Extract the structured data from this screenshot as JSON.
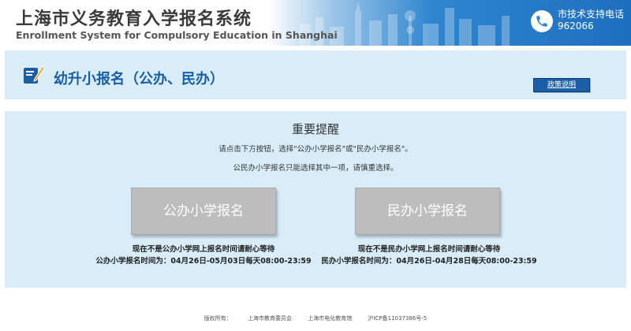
{
  "header": {
    "title_cn": "上海市义务教育入学报名系统",
    "title_en": "Enrollment System for Compulsory Education in Shanghai",
    "hotline_label": "市技术支持电话",
    "hotline_number": "962066",
    "phone_icon": "phone-icon"
  },
  "section": {
    "icon": "edit-icon",
    "title": "幼升小报名（公办、民办）",
    "policy_button": "政策说明"
  },
  "notice": {
    "title": "重要提醒",
    "line1": "请点击下方按钮，选择\"公办小学报名\"或\"民办小学报名\"。",
    "line2": "公民办小学报名只能选择其中一项，请慎重选择。"
  },
  "public": {
    "button": "公办小学报名",
    "status": "现在不是公办小学网上报名时间请耐心等待",
    "period": "公办小学报名时间为：04月26日-05月03日每天08:00-23:59"
  },
  "private": {
    "button": "民办小学报名",
    "status": "现在不是民办小学网上报名时间请耐心等待",
    "period": "民办小学报名时间为：04月26日-04月28日每天08:00-23:59"
  },
  "footer": {
    "copyright": "版权所有：",
    "org1": "上海市教育委员会",
    "org2": "上海市电化教育馆",
    "icp": "沪ICP备11037386号-5"
  },
  "colors": {
    "brand_blue": "#1a5ea8",
    "panel_bg": "#d8edf8",
    "button_disabled": "#bdbdbd"
  }
}
